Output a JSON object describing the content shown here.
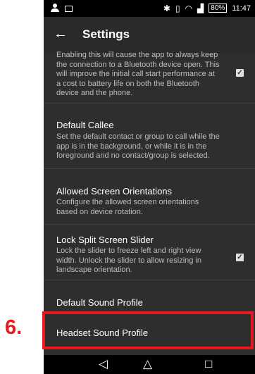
{
  "status_bar": {
    "battery": "80%",
    "time": "11:47",
    "icons": [
      "person-icon",
      "image-icon",
      "bluetooth-icon",
      "vibrate-icon",
      "wifi-icon",
      "signal-icon",
      "battery-icon"
    ]
  },
  "app_bar": {
    "back_icon": "←",
    "title": "Settings"
  },
  "preferences": [
    {
      "title": "",
      "summary": "Enabling this will cause the app to always keep the connection to a Bluetooth device open. This will improve the initial call start performance at a cost to battery life on both the Bluetooth device and the phone.",
      "checked": true
    },
    {
      "title": "Default Callee",
      "summary": "Set the default contact or group to call while the app is in the background, or while it is in the foreground and no contact/group is selected."
    },
    {
      "title": "Allowed Screen Orientations",
      "summary": "Configure the allowed screen orientations based on device rotation."
    },
    {
      "title": "Lock Split Screen Slider",
      "summary": "Lock the slider to freeze left and right view width. Unlock the slider to allow resizing in landscape orientation.",
      "checked": true
    },
    {
      "title": "Default Sound Profile",
      "summary": ""
    },
    {
      "title": "Headset Sound Profile",
      "summary": ""
    }
  ],
  "annotation": {
    "step_number": "6.",
    "color": "#e8181e"
  },
  "nav_bar": {
    "back": "◁",
    "home": "△",
    "recents": "□"
  },
  "colors": {
    "background": "#2e2e2e",
    "status_bar": "#000000",
    "text_primary": "#ffffff",
    "text_secondary": "#bdbdbd"
  }
}
